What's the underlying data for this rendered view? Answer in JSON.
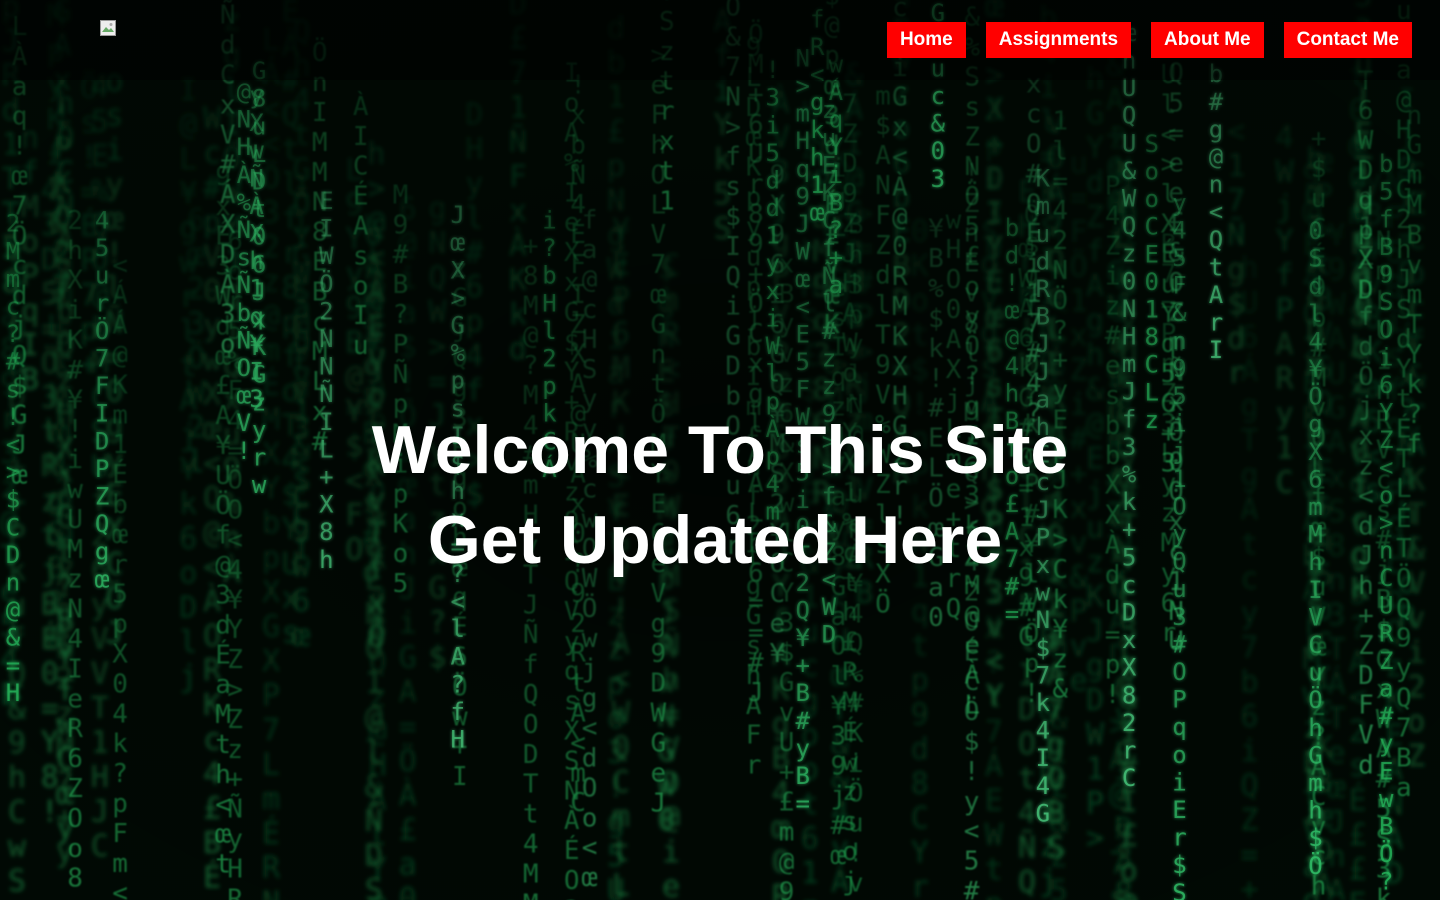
{
  "header": {
    "logo_icon": "broken-image-icon",
    "nav": [
      {
        "label": "Home"
      },
      {
        "label": "Assignments"
      },
      {
        "label": "About Me"
      },
      {
        "label": "Contact Me"
      }
    ],
    "nav_color": "#ff0000"
  },
  "hero": {
    "line1": "Welcome To This Site",
    "line2": "Get Updated Here",
    "background": "matrix-code-rain",
    "accent_green": "#2bd46a"
  }
}
